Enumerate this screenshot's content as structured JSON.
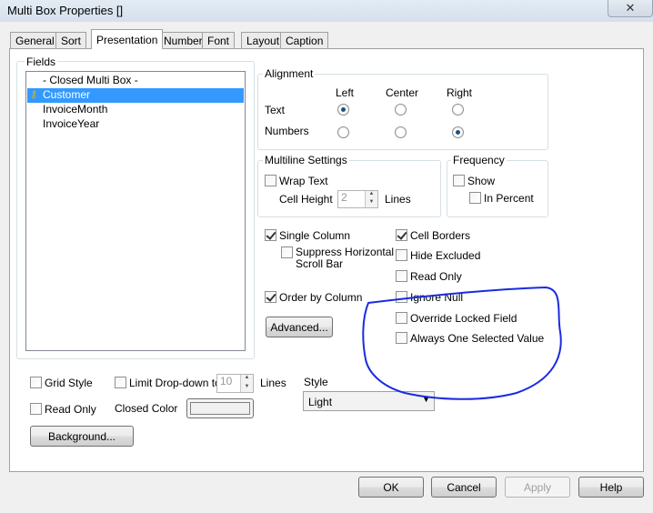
{
  "window": {
    "title": "Multi Box Properties []",
    "close_symbol": "✕"
  },
  "tabs": [
    {
      "label": "General"
    },
    {
      "label": "Sort"
    },
    {
      "label": "Presentation"
    },
    {
      "label": "Number"
    },
    {
      "label": "Font"
    },
    {
      "label": "Layout"
    },
    {
      "label": "Caption"
    }
  ],
  "fields": {
    "label": "Fields",
    "items": [
      "- Closed Multi Box -",
      "Customer",
      "InvoiceMonth",
      "InvoiceYear"
    ]
  },
  "alignment": {
    "label": "Alignment",
    "columns": [
      "Left",
      "Center",
      "Right"
    ],
    "rows": [
      "Text",
      "Numbers"
    ]
  },
  "multiline": {
    "label": "Multiline Settings",
    "wrap_text": "Wrap Text",
    "cell_height": "Cell Height",
    "cell_height_value": "2",
    "lines": "Lines"
  },
  "frequency": {
    "label": "Frequency",
    "show": "Show",
    "in_percent": "In Percent"
  },
  "options": {
    "single_column": "Single Column",
    "suppress_scroll_1": "Suppress Horizontal",
    "suppress_scroll_2": "Scroll Bar",
    "order_by_column": "Order by Column",
    "advanced": "Advanced...",
    "cell_borders": "Cell Borders",
    "hide_excluded": "Hide Excluded",
    "read_only": "Read Only",
    "ignore_null": "Ignore Null",
    "override_locked": "Override Locked Field",
    "always_one": "Always One Selected Value"
  },
  "bottom": {
    "grid_style": "Grid Style",
    "limit_dropdown": "Limit Drop-down to",
    "limit_value": "10",
    "lines": "Lines",
    "style_label": "Style",
    "style_value": "Light",
    "read_only": "Read Only",
    "closed_color": "Closed Color",
    "background": "Background..."
  },
  "footer": {
    "ok": "OK",
    "cancel": "Cancel",
    "apply": "Apply",
    "help": "Help"
  },
  "colors": {
    "selection": "#3399ff",
    "annotation": "#1a2be0",
    "radio_dot": "#1c5180"
  }
}
